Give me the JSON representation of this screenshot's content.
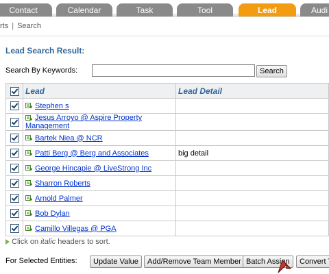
{
  "tabs": [
    {
      "label": "Contact",
      "active": false
    },
    {
      "label": "Calendar",
      "active": false
    },
    {
      "label": "Task",
      "active": false
    },
    {
      "label": "Tool",
      "active": false
    },
    {
      "label": "Lead",
      "active": true
    },
    {
      "label": "Audi",
      "active": false
    }
  ],
  "breadcrumb": {
    "first": "rts",
    "sep": "|",
    "second": "Search"
  },
  "page_title": "Lead Search Result:",
  "search": {
    "label": "Search By Keywords:",
    "value": "",
    "button": "Search"
  },
  "table": {
    "headers": {
      "lead": "Lead",
      "detail": "Lead Detail"
    },
    "rows": [
      {
        "lead": "Stephen s",
        "detail": "",
        "checked": true
      },
      {
        "lead": "Jesus Arroyo @ Aspire Property Management",
        "detail": "",
        "checked": true
      },
      {
        "lead": "Bartek Niea @ NCR",
        "detail": "",
        "checked": true
      },
      {
        "lead": "Patti Berg @ Berg and Associates",
        "detail": "big detail",
        "checked": true
      },
      {
        "lead": "George Hincapie @ LiveStrong Inc",
        "detail": "",
        "checked": true
      },
      {
        "lead": "Sharron Roberts",
        "detail": "",
        "checked": true
      },
      {
        "lead": "Arnold Palmer",
        "detail": "",
        "checked": true
      },
      {
        "lead": "Bob Dylan",
        "detail": "",
        "checked": true
      },
      {
        "lead": "Camillo Villegas @ PGA",
        "detail": "",
        "checked": true
      }
    ]
  },
  "hint": {
    "prefix": "Click on ",
    "italic": "italic",
    "suffix": " headers to sort."
  },
  "actions": {
    "label": "For Selected Entities:",
    "update_value": "Update Value",
    "team_member": "Add/Remove Team Member",
    "batch_assign": "Batch Assign",
    "convert": "Convert T"
  },
  "colors": {
    "accent": "#f39c12",
    "tab": "#8a8a8a",
    "title": "#336699",
    "link": "#0033cc"
  }
}
